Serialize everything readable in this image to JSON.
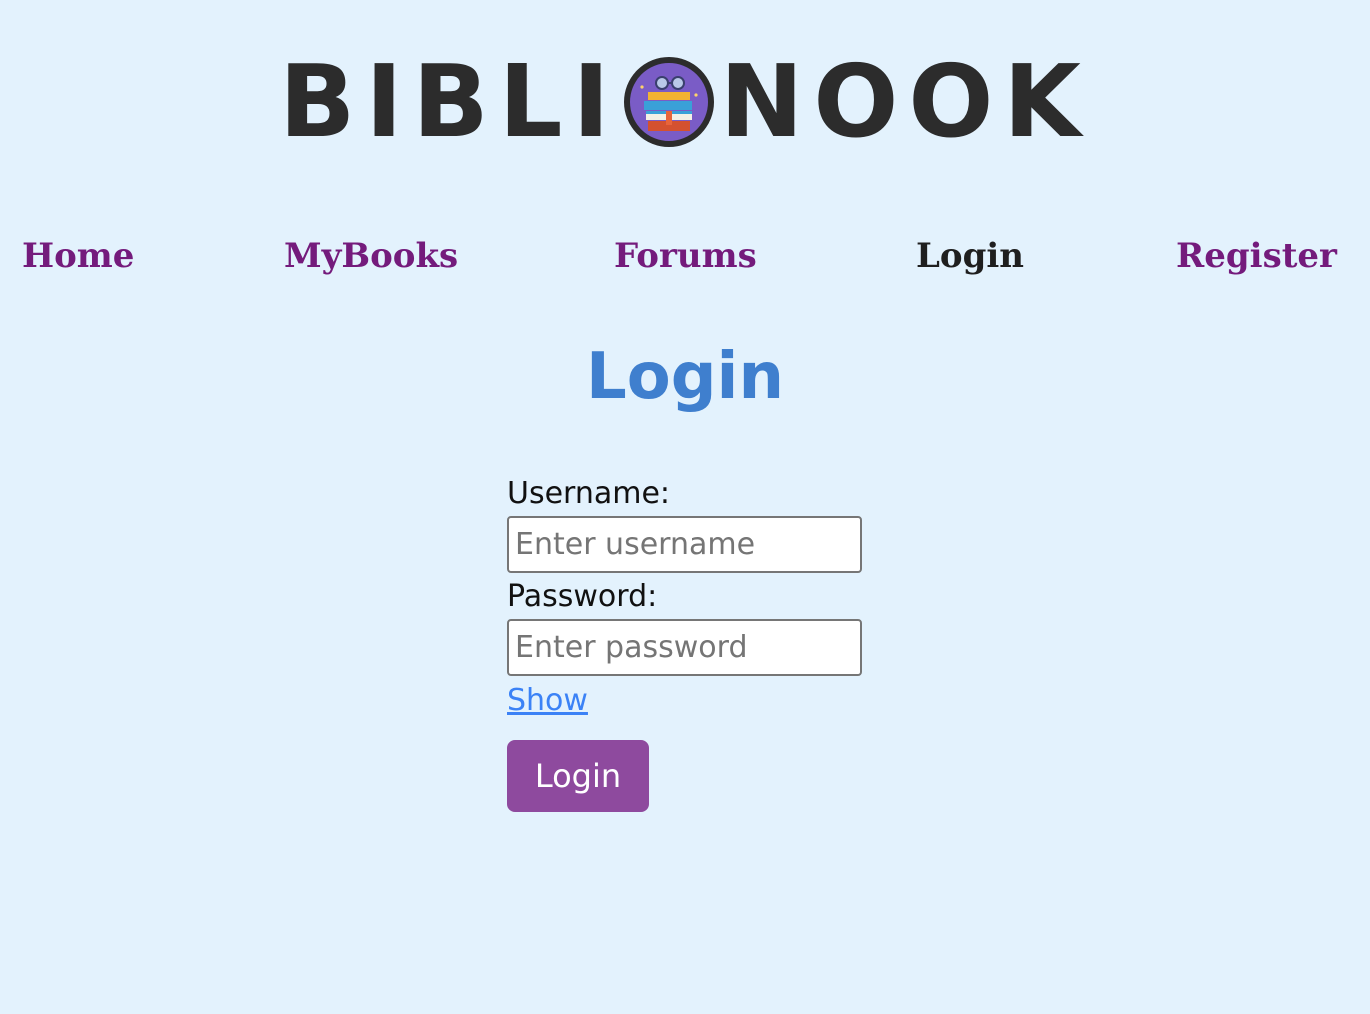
{
  "header": {
    "logo_left": "BIBLI",
    "logo_right": "NOOK"
  },
  "nav": {
    "items": [
      {
        "label": "Home"
      },
      {
        "label": "MyBooks"
      },
      {
        "label": "Forums"
      },
      {
        "label": "Login",
        "active": true
      },
      {
        "label": "Register"
      }
    ]
  },
  "main": {
    "title": "Login",
    "form": {
      "username_label": "Username:",
      "username_placeholder": "Enter username",
      "password_label": "Password:",
      "password_placeholder": "Enter password",
      "show_label": "Show",
      "submit_label": "Login"
    }
  },
  "colors": {
    "background": "#e3f2fd",
    "nav_link": "#741b7c",
    "nav_active": "#1f1f1f",
    "title": "#3f7fce",
    "button": "#8e4a9e",
    "link": "#3b82f6"
  },
  "icons": {
    "logo_badge": "books-stack-icon"
  }
}
